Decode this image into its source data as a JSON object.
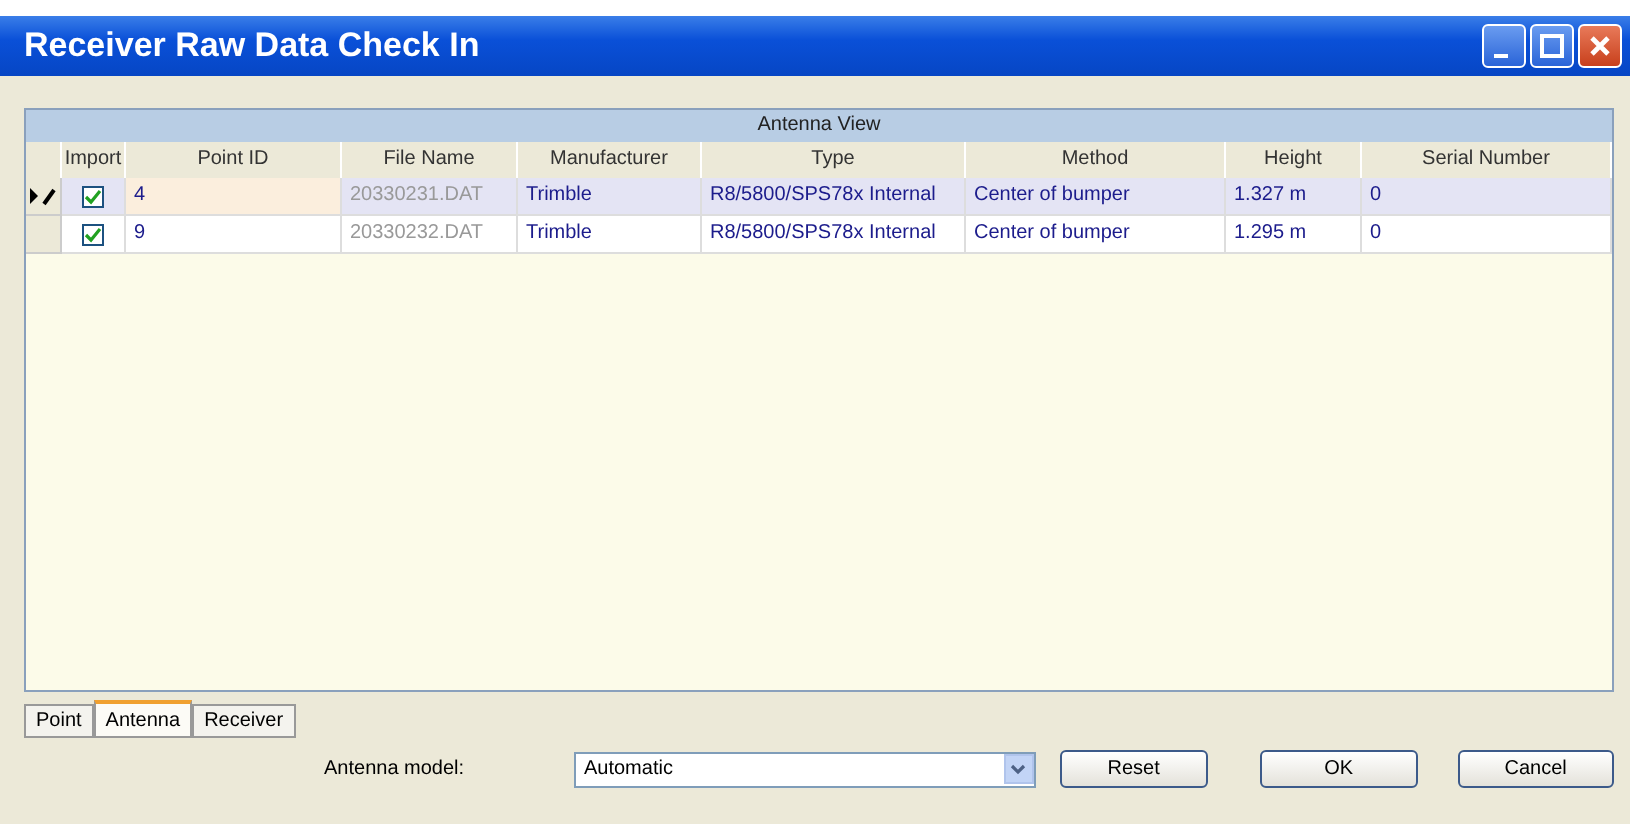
{
  "window": {
    "title": "Receiver Raw Data Check In"
  },
  "grid": {
    "caption": "Antenna View",
    "columns": [
      "Import",
      "Point ID",
      "File Name",
      "Manufacturer",
      "Type",
      "Method",
      "Height",
      "Serial Number"
    ],
    "rows": [
      {
        "current": true,
        "editing": true,
        "import": true,
        "point_id": "4",
        "file_name": "20330231.DAT",
        "manufacturer": "Trimble",
        "type": "R8/5800/SPS78x Internal",
        "method": "Center of bumper",
        "height": "1.327 m",
        "serial_number": "0"
      },
      {
        "current": false,
        "editing": false,
        "import": true,
        "point_id": "9",
        "file_name": "20330232.DAT",
        "manufacturer": "Trimble",
        "type": "R8/5800/SPS78x Internal",
        "method": "Center of bumper",
        "height": "1.295 m",
        "serial_number": "0"
      }
    ]
  },
  "tabs": [
    {
      "label": "Point",
      "selected": false
    },
    {
      "label": "Antenna",
      "selected": true
    },
    {
      "label": "Receiver",
      "selected": false
    }
  ],
  "antenna_model": {
    "label": "Antenna model:",
    "value": "Automatic"
  },
  "buttons": [
    "Reset",
    "OK",
    "Cancel"
  ]
}
